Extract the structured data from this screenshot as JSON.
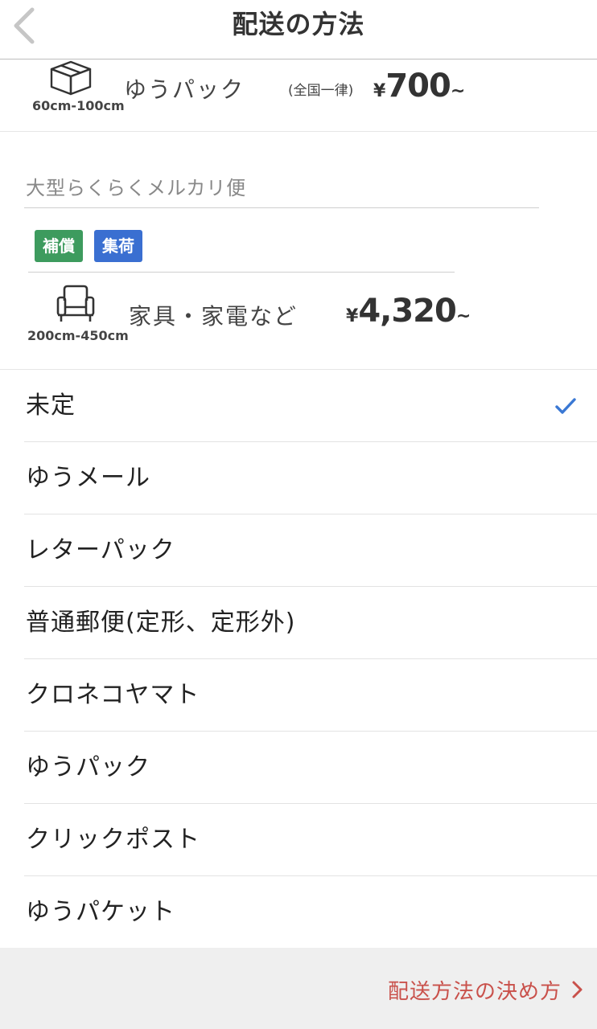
{
  "header": {
    "title": "配送の方法",
    "back_icon": "chevron-left-icon"
  },
  "yupack": {
    "icon": "box-icon",
    "size": "60cm-100cm",
    "name": "ゆうパック",
    "note": "(全国一律)",
    "price_currency": "¥",
    "price_value": "700",
    "price_suffix": "~"
  },
  "large": {
    "title": "大型らくらくメルカリ便",
    "badges": [
      "補償",
      "集荷"
    ],
    "badge_colors": [
      "#3d9b5e",
      "#3a6fd1"
    ],
    "icon": "armchair-icon",
    "size": "200cm-450cm",
    "name": "家具・家電など",
    "price_currency": "¥",
    "price_value": "4,320",
    "price_suffix": "~"
  },
  "options": [
    {
      "label": "未定",
      "selected": true
    },
    {
      "label": "ゆうメール",
      "selected": false
    },
    {
      "label": "レターパック",
      "selected": false
    },
    {
      "label": "普通郵便(定形、定形外)",
      "selected": false
    },
    {
      "label": "クロネコヤマト",
      "selected": false
    },
    {
      "label": "ゆうパック",
      "selected": false
    },
    {
      "label": "クリックポスト",
      "selected": false
    },
    {
      "label": "ゆうパケット",
      "selected": false
    }
  ],
  "footer": {
    "link_label": "配送方法の決め方",
    "link_color": "#c9514b"
  },
  "colors": {
    "check": "#3a78d4"
  }
}
